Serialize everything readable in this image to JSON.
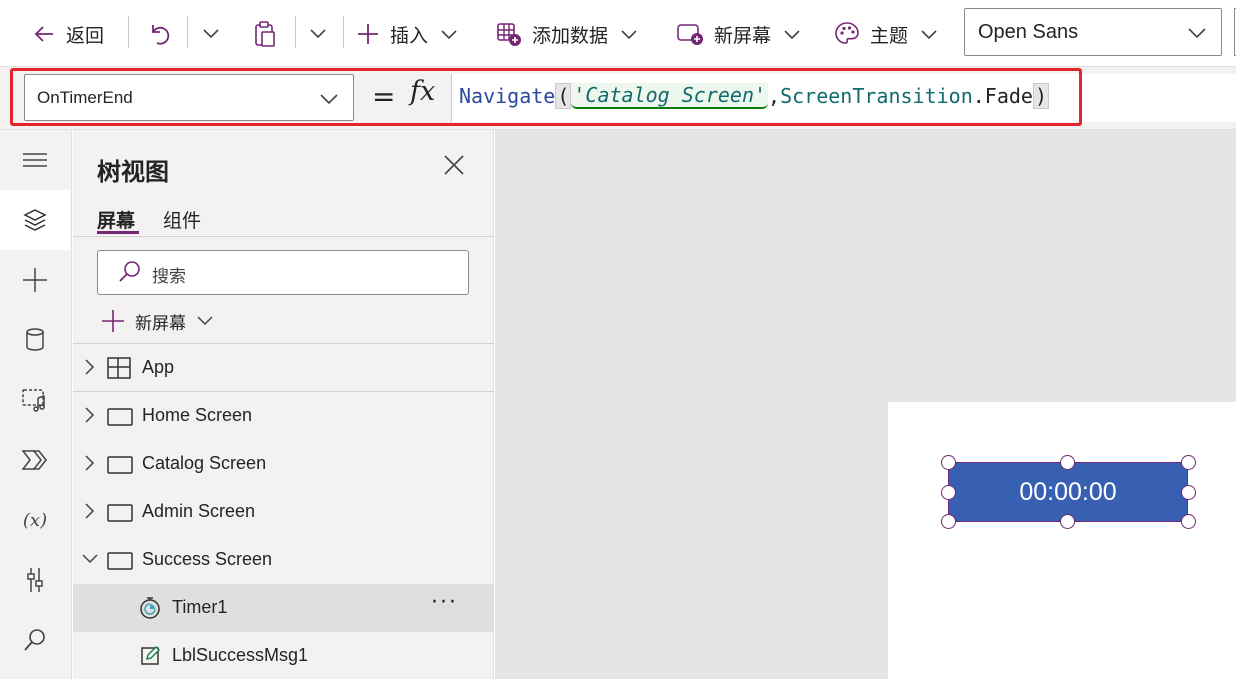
{
  "toolbar": {
    "back_label": "返回",
    "insert_label": "插入",
    "add_data_label": "添加数据",
    "new_screen_label": "新屏幕",
    "theme_label": "主题",
    "font_value": "Open Sans"
  },
  "formula_bar": {
    "property": "OnTimerEnd",
    "equals": "=",
    "fx": "fx",
    "formula": {
      "fn": "Navigate",
      "open": "(",
      "arg1": "'Catalog Screen'",
      "comma": ",",
      "arg2_obj": "ScreenTransition",
      "dot": ".",
      "arg2_member": "Fade",
      "close": ")"
    }
  },
  "tree": {
    "title": "树视图",
    "tabs": [
      "屏幕",
      "组件"
    ],
    "search_placeholder": "搜索",
    "new_screen_label": "新屏幕",
    "items": [
      {
        "label": "App",
        "icon": "app-icon"
      },
      {
        "label": "Home Screen",
        "icon": "screen-icon"
      },
      {
        "label": "Catalog Screen",
        "icon": "screen-icon"
      },
      {
        "label": "Admin Screen",
        "icon": "screen-icon"
      },
      {
        "label": "Success Screen",
        "icon": "screen-icon"
      },
      {
        "label": "Timer1",
        "icon": "timer-icon"
      },
      {
        "label": "LblSuccessMsg1",
        "icon": "label-edit-icon"
      }
    ],
    "more_label": "···"
  },
  "canvas": {
    "timer_text": "00:00:00"
  },
  "colors": {
    "accent": "#742774",
    "timer_fill": "#3860b2",
    "highlight": "#e3242b"
  }
}
